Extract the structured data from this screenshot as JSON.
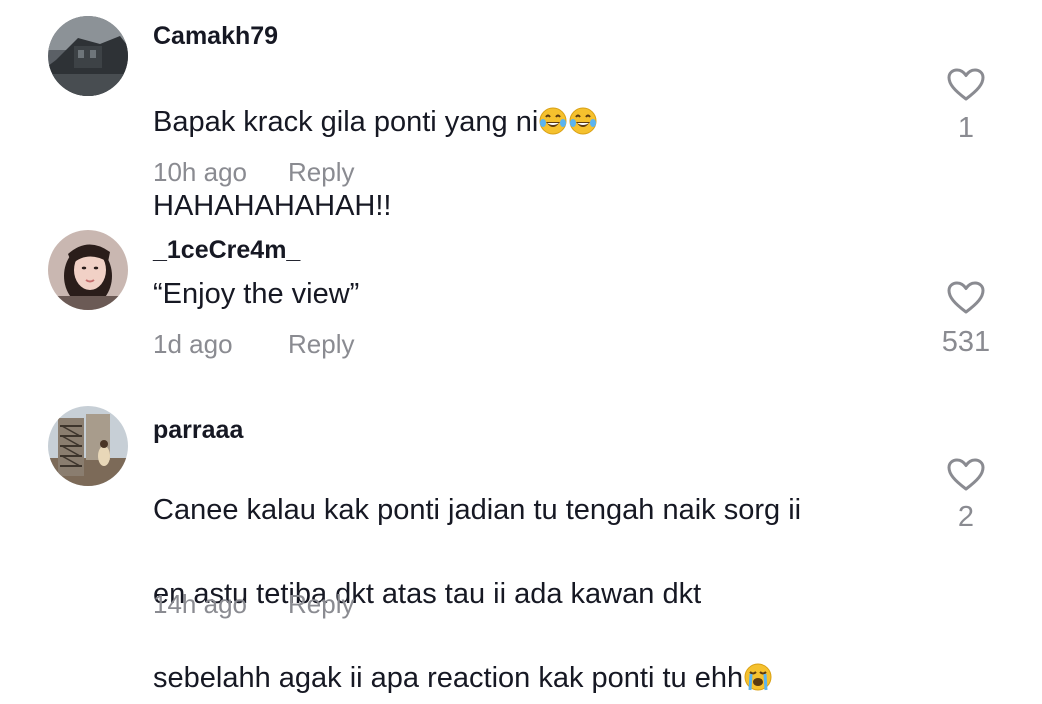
{
  "comments": [
    {
      "username": "Camakh79",
      "text": "Bapak krack gila ponti yang ni",
      "text_line2": "HAHAHAHAHAH!!",
      "emojis": [
        "face-with-tears-of-joy-emoji",
        "face-with-tears-of-joy-emoji"
      ],
      "time": "10h ago",
      "reply_label": "Reply",
      "likes": "1"
    },
    {
      "username": "_1ceCre4m_",
      "text": "“Enjoy the view”",
      "time": "1d ago",
      "reply_label": "Reply",
      "likes": "531"
    },
    {
      "username": "parraaa",
      "text_line1": "Canee kalau kak ponti jadian tu tengah naik sorg ii",
      "text_line2": "en astu tetiba dkt atas tau ii ada kawan dkt",
      "text_line3": "sebelahh agak ii apa reaction kak ponti tu ehh",
      "emojis": [
        "loudly-crying-face-emoji"
      ],
      "time": "14h ago",
      "reply_label": "Reply",
      "likes": "2"
    }
  ],
  "colors": {
    "text": "#161823",
    "muted": "#8a8b91",
    "icon": "#8a8b91"
  }
}
